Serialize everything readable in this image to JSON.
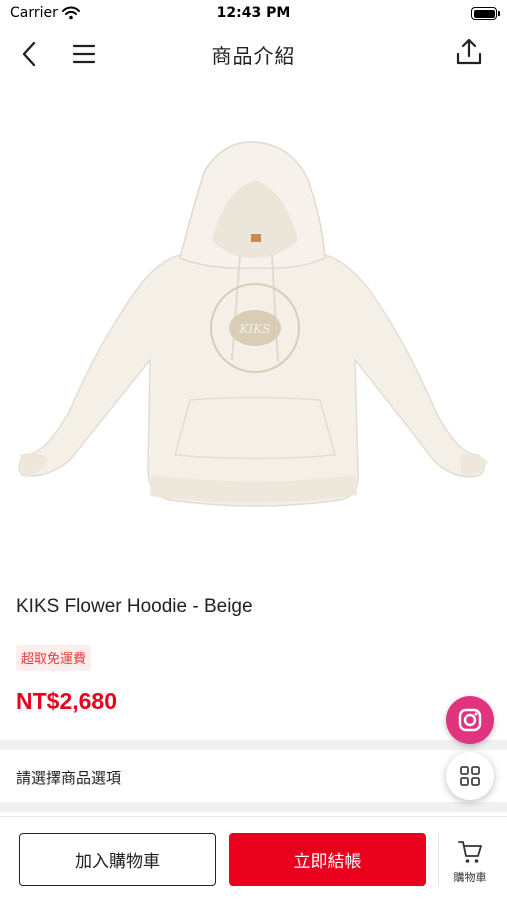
{
  "status_bar": {
    "carrier": "Carrier",
    "time": "12:43 PM"
  },
  "nav": {
    "title": "商品介紹"
  },
  "product": {
    "name": "KIKS Flower Hoodie - Beige",
    "shipping_tag": "超取免運費",
    "price": "NT$2,680",
    "image_print": "KIKS"
  },
  "options": {
    "label": "請選擇商品選項"
  },
  "bottom_bar": {
    "add_to_cart": "加入購物車",
    "buy_now": "立即結帳",
    "cart_label": "購物車"
  },
  "colors": {
    "accent": "#e8001c",
    "tag_bg": "#fdeeee",
    "tag_text": "#e53a3a",
    "instagram": "#e0347f",
    "hoodie": "#f4f0e8"
  },
  "icons": [
    "back-icon",
    "menu-icon",
    "share-icon",
    "instagram-icon",
    "grid-icon",
    "cart-icon",
    "wifi-icon",
    "battery-icon"
  ]
}
